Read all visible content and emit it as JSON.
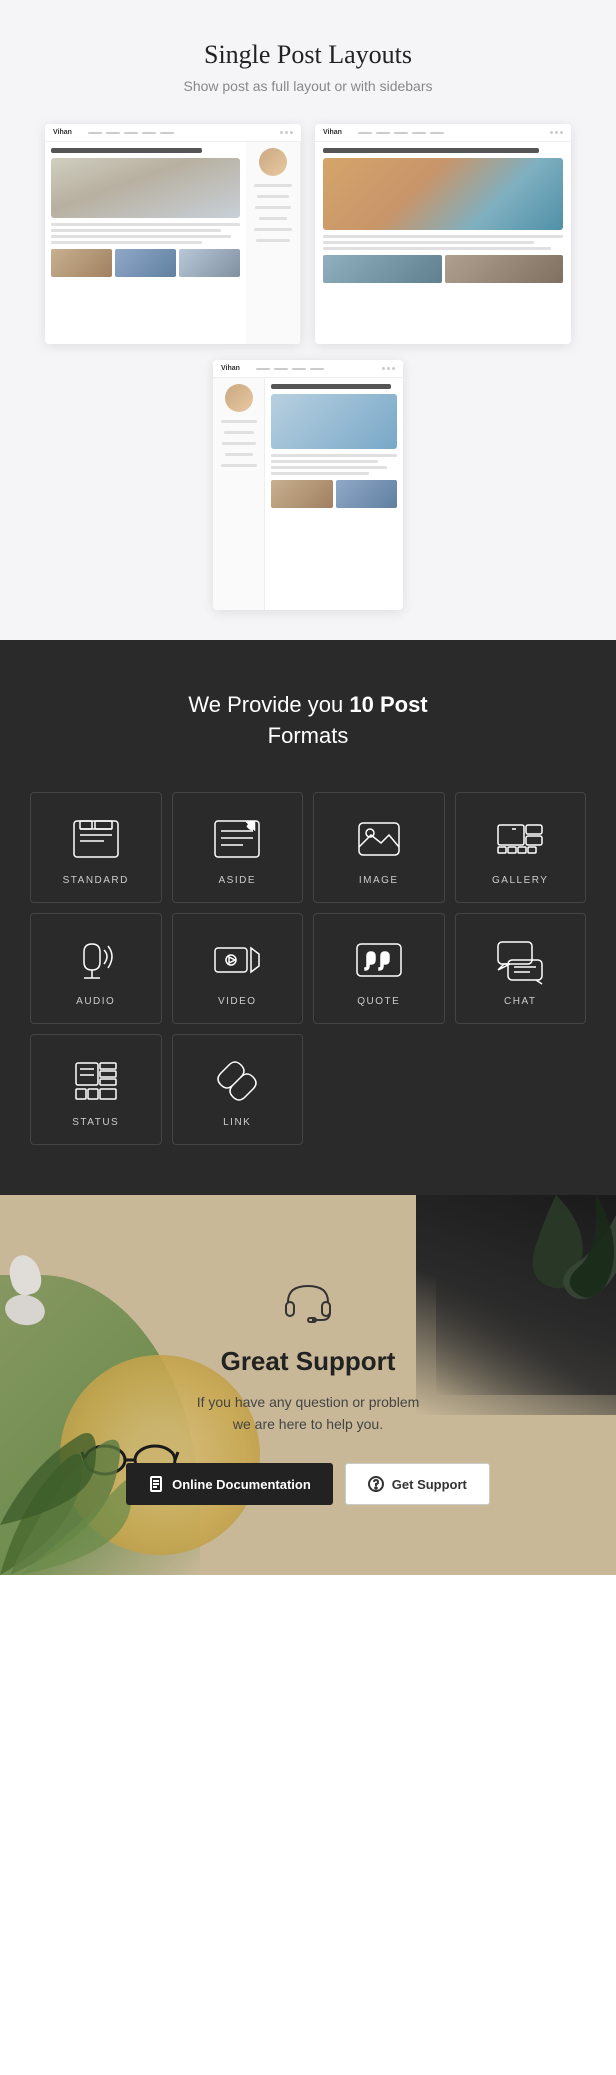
{
  "section1": {
    "title": "Single Post Layouts",
    "subtitle": "Show post as full layout or with sidebars"
  },
  "section2": {
    "title_prefix": "We Provide you ",
    "title_bold": "10 Post",
    "title_suffix": " Formats",
    "formats": [
      {
        "id": "standard",
        "label": "STANDARD"
      },
      {
        "id": "aside",
        "label": "ASIDE"
      },
      {
        "id": "image",
        "label": "IMAGE"
      },
      {
        "id": "gallery",
        "label": "GALLERY"
      },
      {
        "id": "audio",
        "label": "AUDIO"
      },
      {
        "id": "video",
        "label": "VIDEO"
      },
      {
        "id": "quote",
        "label": "QUOTE"
      },
      {
        "id": "chat",
        "label": "CHAT"
      },
      {
        "id": "status",
        "label": "STATUS"
      },
      {
        "id": "link",
        "label": "LINK"
      }
    ]
  },
  "section3": {
    "title": "Great Support",
    "text_line1": "If you have any question or problem",
    "text_line2": "we are here to help you.",
    "btn_doc_label": "Online Documentation",
    "btn_support_label": "Get Support"
  }
}
